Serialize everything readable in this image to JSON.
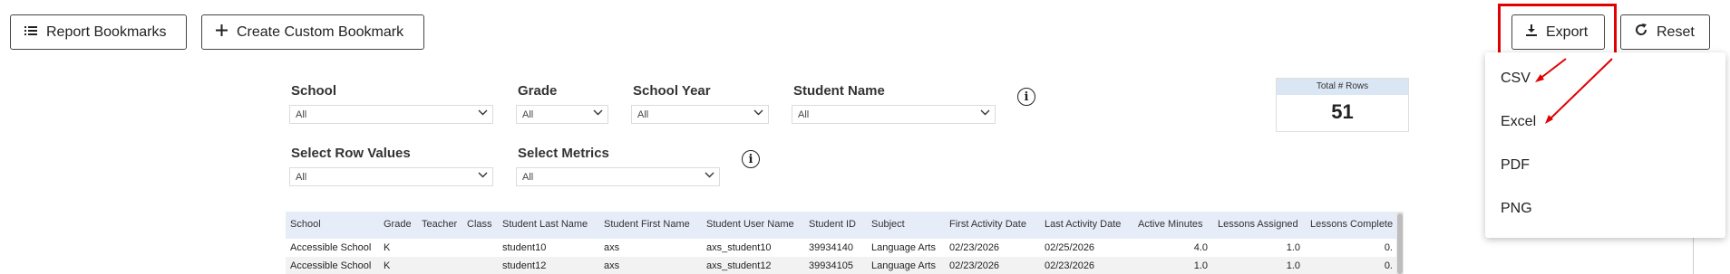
{
  "toolbar": {
    "report_bookmarks_label": "Report Bookmarks",
    "create_bookmark_label": "Create Custom Bookmark",
    "export_label": "Export",
    "reset_label": "Reset"
  },
  "filters": {
    "school": {
      "label": "School",
      "value": "All"
    },
    "grade": {
      "label": "Grade",
      "value": "All"
    },
    "school_year": {
      "label": "School Year",
      "value": "All"
    },
    "student_name": {
      "label": "Student Name",
      "value": "All"
    },
    "row_values": {
      "label": "Select Row Values",
      "value": "All"
    },
    "metrics": {
      "label": "Select Metrics",
      "value": "All"
    }
  },
  "total_rows": {
    "label": "Total # Rows",
    "value": "51"
  },
  "table": {
    "headers": [
      "School",
      "Grade",
      "Teacher",
      "Class",
      "Student Last Name",
      "Student First Name",
      "Student User Name",
      "Student ID",
      "Subject",
      "First Activity Date",
      "Last Activity Date",
      "Active Minutes",
      "Lessons Assigned",
      "Lessons Complete"
    ],
    "rows": [
      [
        "Accessible School",
        "K",
        "",
        "",
        "student10",
        "axs",
        "axs_student10",
        "39934140",
        "Language Arts",
        "02/23/2026",
        "02/25/2026",
        "4.0",
        "1.0",
        "0."
      ],
      [
        "Accessible School",
        "K",
        "",
        "",
        "student12",
        "axs",
        "axs_student12",
        "39934105",
        "Language Arts",
        "02/23/2026",
        "02/23/2026",
        "1.0",
        "1.0",
        "0."
      ]
    ]
  },
  "export_menu": {
    "items": [
      "CSV",
      "Excel",
      "PDF",
      "PNG"
    ]
  },
  "colors": {
    "highlight": "#e00000",
    "header_bg": "#e6ecf8",
    "card_header_bg": "#dbe6f5"
  },
  "icons": {
    "report_bookmarks": "list-icon",
    "create_bookmark": "plus-icon",
    "export": "download-icon",
    "reset": "refresh-icon",
    "info": "info-icon",
    "select": "chevron-down-icon"
  }
}
